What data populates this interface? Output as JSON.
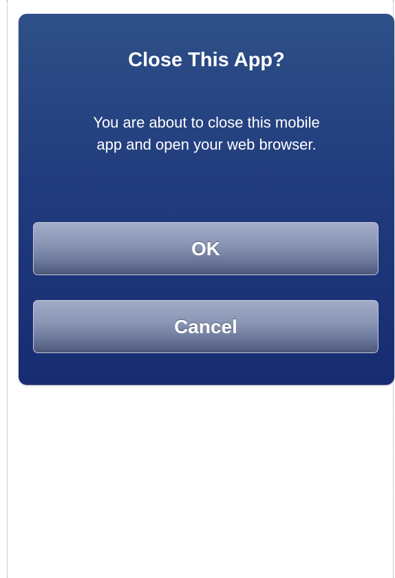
{
  "dialog": {
    "title": "Close This App?",
    "message_line1": "You are about to close this mobile",
    "message_line2": "app and open your web browser.",
    "ok_label": "OK",
    "cancel_label": "Cancel"
  },
  "colors": {
    "dialog_top": "#2f5088",
    "dialog_bottom": "#172c72",
    "button_top": "#a2acc8",
    "button_bottom": "#4c5779",
    "text": "#ffffff"
  }
}
